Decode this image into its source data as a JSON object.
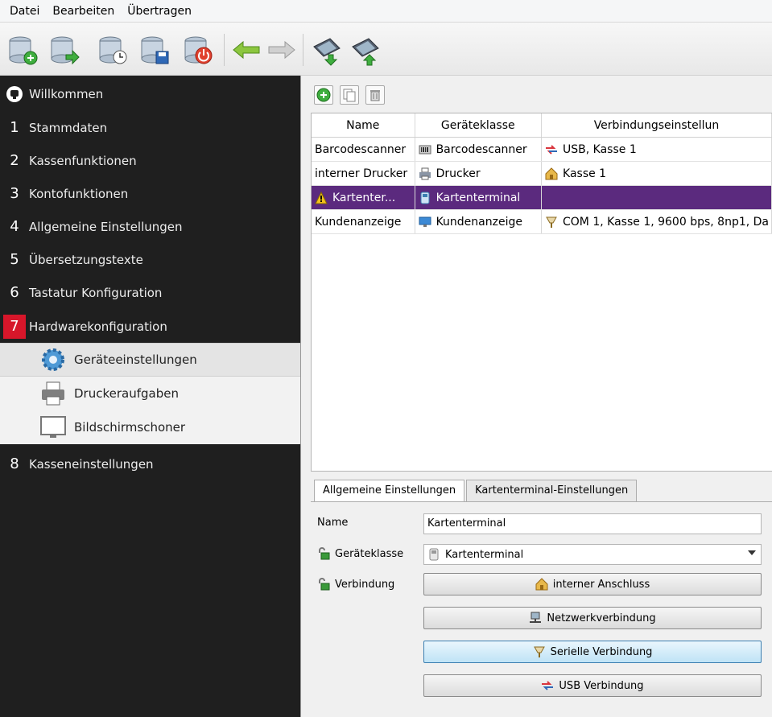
{
  "menu": [
    "Datei",
    "Bearbeiten",
    "Übertragen"
  ],
  "toolbar": {
    "buttons": [
      "db-add-icon",
      "db-export-icon",
      "db-schedule-icon",
      "db-save-icon",
      "power-off-icon",
      "arrow-left-icon",
      "arrow-right-icon",
      "device-download-icon",
      "device-upload-icon"
    ]
  },
  "sidebar": {
    "welcome": "Willkommen",
    "items": [
      {
        "num": "1",
        "label": "Stammdaten"
      },
      {
        "num": "2",
        "label": "Kassenfunktionen"
      },
      {
        "num": "3",
        "label": "Kontofunktionen"
      },
      {
        "num": "4",
        "label": "Allgemeine Einstellungen"
      },
      {
        "num": "5",
        "label": "Übersetzungstexte"
      },
      {
        "num": "6",
        "label": "Tastatur Konfiguration"
      },
      {
        "num": "7",
        "label": "Hardwarekonfiguration"
      },
      {
        "num": "8",
        "label": "Kasseneinstellungen"
      }
    ],
    "subitems": [
      "Geräteeinstellungen",
      "Druckeraufgaben",
      "Bildschirmschoner"
    ],
    "active_color": "#d7162a"
  },
  "table": {
    "headers": [
      "Name",
      "Geräteklasse",
      "Verbindungseinstellun"
    ],
    "rows": [
      {
        "name": "Barcodescanner",
        "klasse": "Barcodescanner",
        "verbindung": "USB, Kasse 1"
      },
      {
        "name": "interner Drucker",
        "klasse": "Drucker",
        "verbindung": "Kasse 1"
      },
      {
        "name": "Kartenter...",
        "klasse": "Kartenterminal",
        "verbindung": ""
      },
      {
        "name": "Kundenanzeige",
        "klasse": "Kundenanzeige",
        "verbindung": "COM 1, Kasse 1, 9600 bps, 8np1, Da"
      }
    ],
    "selected_color": "#5b2a7e"
  },
  "tabs": [
    "Allgemeine Einstellungen",
    "Kartenterminal-Einstellungen"
  ],
  "form": {
    "name_label": "Name",
    "name_value": "Kartenterminal",
    "klasse_label": "Geräteklasse",
    "klasse_value": "Kartenterminal",
    "verbindung_label": "Verbindung",
    "buttons": [
      "interner Anschluss",
      "Netzwerkverbindung",
      "Serielle Verbindung",
      "USB Verbindung"
    ]
  }
}
